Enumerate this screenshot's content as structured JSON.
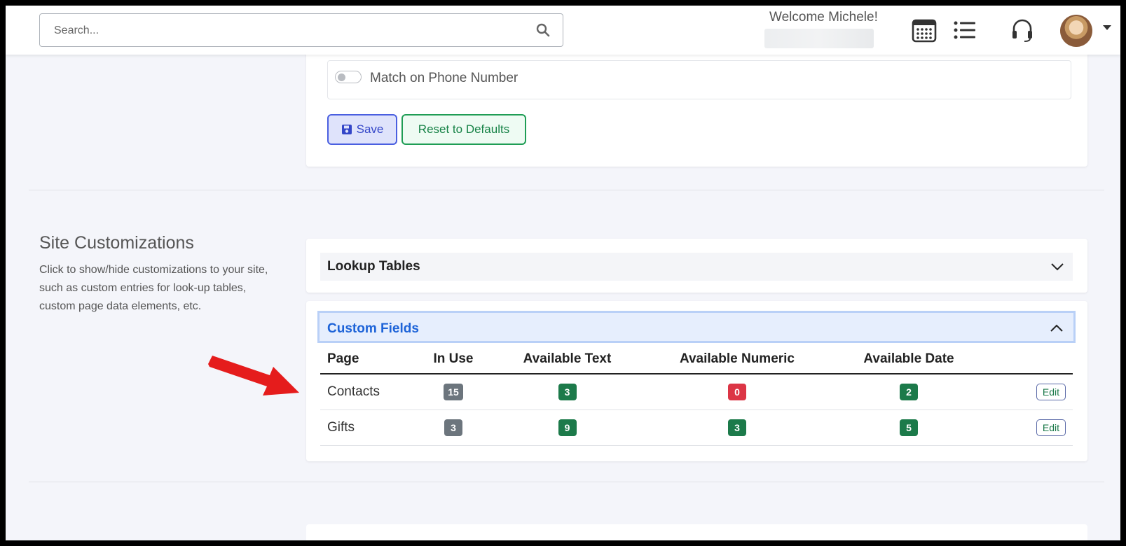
{
  "header": {
    "search_placeholder": "Search...",
    "welcome_text": "Welcome Michele!",
    "icons": [
      "calendar-icon",
      "list-icon",
      "headset-icon",
      "avatar"
    ]
  },
  "settings": {
    "match_phone_label": "Match on Phone Number",
    "match_phone_on": false,
    "save_label": "Save",
    "reset_label": "Reset to Defaults"
  },
  "site_customizations": {
    "title": "Site Customizations",
    "description": "Click to show/hide customizations to your site, such as custom entries for look-up tables, custom page data elements, etc.",
    "lookup_title": "Lookup Tables",
    "custom_fields_title": "Custom Fields",
    "columns": [
      "Page",
      "In Use",
      "Available Text",
      "Available Numeric",
      "Available Date"
    ],
    "rows": [
      {
        "page": "Contacts",
        "in_use": "15",
        "text": "3",
        "numeric": "0",
        "date": "2",
        "edit": "Edit"
      },
      {
        "page": "Gifts",
        "in_use": "3",
        "text": "9",
        "numeric": "3",
        "date": "5",
        "edit": "Edit"
      }
    ]
  },
  "colors": {
    "accent_blue": "#1d63d8",
    "badge_green": "#1c7a4a",
    "badge_red": "#dc3545",
    "badge_gray": "#6c757d",
    "annotation_arrow": "#e51c1c"
  }
}
